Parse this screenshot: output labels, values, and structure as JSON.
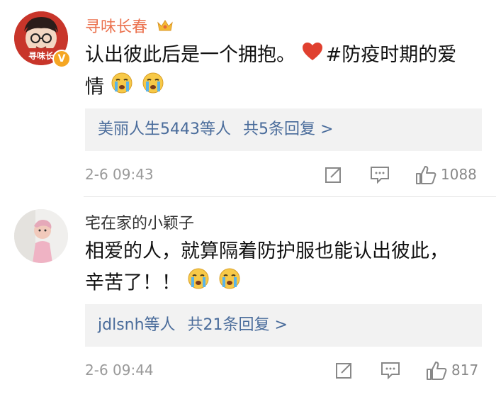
{
  "comments": [
    {
      "username": "寻味长春",
      "avatar_text": "寻味长",
      "verified_badge": "V",
      "text_main": "认出彼此后是一个拥抱。",
      "hashtag": "#防疫时期的爱",
      "text_tail": "情",
      "replies_users": "美丽人生5443等人",
      "replies_count": "共5条回复 >",
      "time": "2-6 09:43",
      "likes": "1088"
    },
    {
      "username": "宅在家的小颖子",
      "text_line1": "相爱的人，就算隔着防护服也能认出彼此，",
      "text_line2": "辛苦了！！",
      "replies_users": "jdlsnh等人",
      "replies_count": "共21条回复 >",
      "time": "2-6 09:44",
      "likes": "817"
    }
  ],
  "colors": {
    "link": "#4a6c9b",
    "verified_name": "#eb7350",
    "muted": "#999999",
    "heart": "#e0402f"
  },
  "icons": [
    "vip-crown-icon",
    "heart-icon",
    "crying-emoji-icon",
    "share-icon",
    "comment-icon",
    "like-thumb-icon"
  ]
}
